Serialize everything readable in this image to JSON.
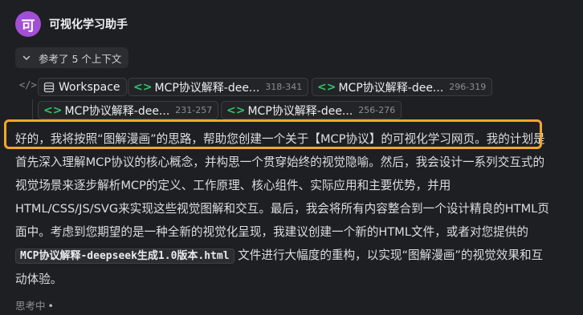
{
  "header": {
    "avatar_char": "可",
    "title": "可视化学习助手",
    "avatar_color": "#a24fd6"
  },
  "context": {
    "label": "参考了 5 个上下文"
  },
  "code_glyph": "</>",
  "chips": [
    {
      "kind": "workspace",
      "icon": "database-icon",
      "name": "Workspace"
    },
    {
      "kind": "file",
      "name": "MCP协议解释-dee...",
      "range": "318-341"
    },
    {
      "kind": "file",
      "name": "MCP协议解释-dee...",
      "range": "296-319"
    },
    {
      "kind": "file",
      "name": "MCP协议解释-dee...",
      "range": "231-257"
    },
    {
      "kind": "file",
      "name": "MCP协议解释-dee...",
      "range": "256-276"
    }
  ],
  "message": {
    "part1": "好的，我将按照“图解漫画”的思路，帮助您创建一个关于【MCP协议】的可视化学习网页。我的计划是首先深入理解MCP协议的核心概念，并构思一个贯穿始终的视觉隐喻。然后，我会设计一系列交互式的视觉场景来逐步解析MCP的定义、工作原理、核心组件、实际应用和主要优势，并用HTML/CSS/JS/SVG来实现这些视觉图解和交互。最后，我会将所有内容整合到一个设计精良的HTML页面中。考虑到您期望的是一种全新的视觉化呈现，我建议创建一个新的HTML文件，或者对您提供的 ",
    "code": "MCP协议解释-deepseek生成1.0版本.html",
    "part2": " 文件进行大幅度的重构，以实现“图解漫画”的视觉效果和互动体验。"
  },
  "status": {
    "label": "思考中",
    "dot": "•"
  },
  "colors": {
    "highlight": "#f2a826",
    "bracket": "#34c06a"
  }
}
